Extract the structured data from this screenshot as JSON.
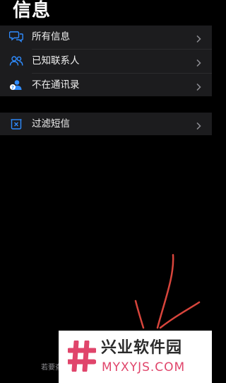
{
  "header": {
    "title": "信息"
  },
  "menu": {
    "items": [
      {
        "label": "所有信息",
        "icon": "chat-bubbles-icon"
      },
      {
        "label": "已知联系人",
        "icon": "contacts-icon"
      },
      {
        "label": "不在通讯录",
        "icon": "unknown-contact-icon"
      }
    ],
    "filter": {
      "label": "过滤短信",
      "icon": "filter-box-icon"
    }
  },
  "footer": {
    "text": "若要查"
  },
  "watermark": {
    "name": "兴业软件园",
    "url": "MYXYJS.COM",
    "brand_color": "#e0456b"
  },
  "colors": {
    "background": "#000000",
    "cell_background": "#1c1c1e",
    "icon_accent": "#2f8cff",
    "chevron": "#8e8e93"
  }
}
